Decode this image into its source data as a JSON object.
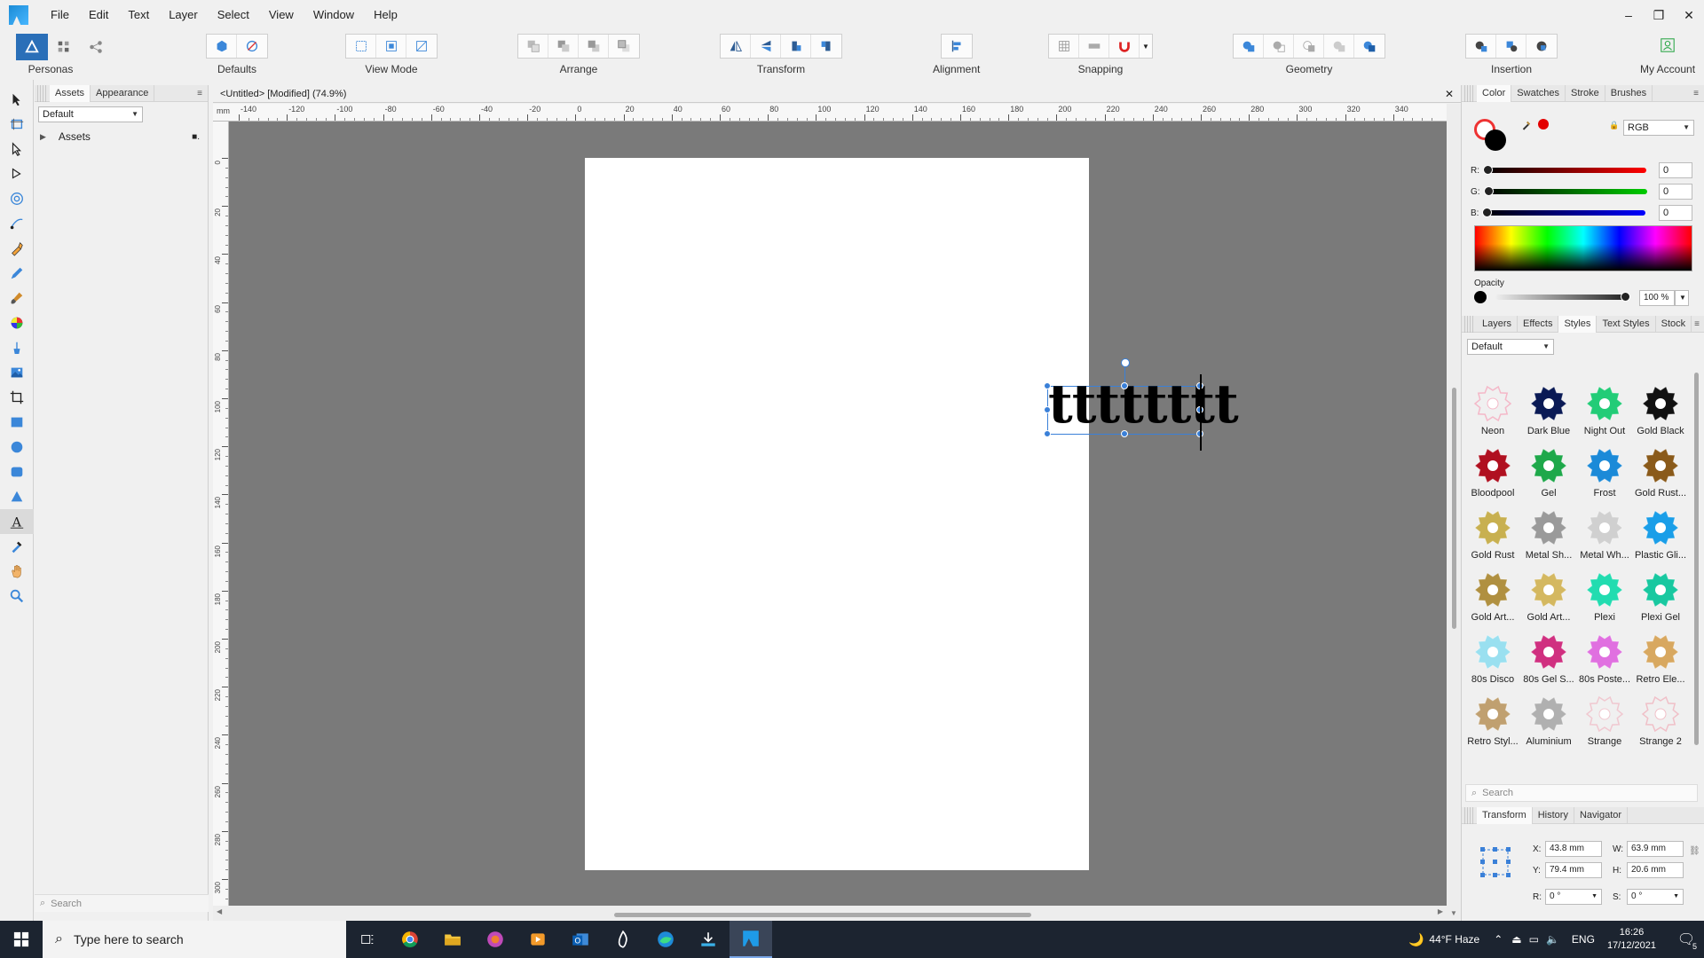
{
  "menubar": {
    "items": [
      "File",
      "Edit",
      "Text",
      "Layer",
      "Select",
      "View",
      "Window",
      "Help"
    ],
    "window_controls": [
      "–",
      "❐",
      "✕"
    ]
  },
  "toolbar": {
    "personas_label": "Personas",
    "defaults_label": "Defaults",
    "view_mode_label": "View Mode",
    "arrange_label": "Arrange",
    "transform_label": "Transform",
    "alignment_label": "Alignment",
    "snapping_label": "Snapping",
    "geometry_label": "Geometry",
    "insertion_label": "Insertion",
    "account_label": "My Account"
  },
  "assets_panel": {
    "tabs": [
      "Assets",
      "Appearance"
    ],
    "dropdown_value": "Default",
    "category": "Assets",
    "search_placeholder": "Search"
  },
  "document": {
    "title": "<Untitled> [Modified] (74.9%)",
    "close": "✕",
    "ruler_unit": "mm",
    "ruler_top_ticks": [
      "-140",
      "-120",
      "-100",
      "-80",
      "-60",
      "-40",
      "-20",
      "0",
      "20",
      "40",
      "60",
      "80",
      "100",
      "120",
      "140",
      "160",
      "180",
      "200",
      "220",
      "240",
      "260",
      "280",
      "300",
      "320",
      "340"
    ],
    "ruler_left_ticks": [
      "0",
      "20",
      "40",
      "60",
      "80",
      "100",
      "120",
      "140",
      "160",
      "180",
      "200",
      "220",
      "240",
      "260",
      "280",
      "300"
    ],
    "text_content": "tttttttt"
  },
  "color_panel": {
    "tabs": [
      "Color",
      "Swatches",
      "Stroke",
      "Brushes"
    ],
    "model": "RGB",
    "channels": [
      {
        "label": "R:",
        "value": "0"
      },
      {
        "label": "G:",
        "value": "0"
      },
      {
        "label": "B:",
        "value": "0"
      }
    ],
    "opacity_label": "Opacity",
    "opacity_value": "100 %",
    "colors": {
      "red": "#e30000",
      "green": "#00b000",
      "blue": "#0000e0"
    }
  },
  "styles_panel": {
    "tabs": [
      "Layers",
      "Effects",
      "Styles",
      "Text Styles",
      "Stock"
    ],
    "dropdown_value": "Default",
    "search_placeholder": "Search",
    "styles": [
      {
        "name": "Neon",
        "color": "#f4b8c8",
        "outline": true
      },
      {
        "name": "Dark Blue",
        "color": "#0a1a55",
        "outline": false
      },
      {
        "name": "Night Out",
        "color": "#22cc77",
        "outline": false
      },
      {
        "name": "Gold Black",
        "color": "#111111",
        "outline": false
      },
      {
        "name": "Bloodpool",
        "color": "#b01020",
        "outline": false
      },
      {
        "name": "Gel",
        "color": "#1ea84a",
        "outline": false
      },
      {
        "name": "Frost",
        "color": "#1b8ad8",
        "outline": false
      },
      {
        "name": "Gold Rust...",
        "color": "#8a5a1a",
        "outline": false
      },
      {
        "name": "Gold Rust",
        "color": "#c8b050",
        "outline": false
      },
      {
        "name": "Metal Sh...",
        "color": "#9a9a9a",
        "outline": false
      },
      {
        "name": "Metal Wh...",
        "color": "#d0d0d0",
        "outline": false
      },
      {
        "name": "Plastic Gli...",
        "color": "#1a9ee8",
        "outline": false
      },
      {
        "name": "Gold Art...",
        "color": "#b09040",
        "outline": false
      },
      {
        "name": "Gold Art...",
        "color": "#d4b860",
        "outline": false
      },
      {
        "name": "Plexi",
        "color": "#22dcb0",
        "outline": false
      },
      {
        "name": "Plexi Gel",
        "color": "#18c8a0",
        "outline": false
      },
      {
        "name": "80s Disco",
        "color": "#9ae0f0",
        "outline": false
      },
      {
        "name": "80s Gel S...",
        "color": "#d03080",
        "outline": false
      },
      {
        "name": "80s Poste...",
        "color": "#e070e0",
        "outline": false
      },
      {
        "name": "Retro Ele...",
        "color": "#d8a860",
        "outline": false
      },
      {
        "name": "Retro Styl...",
        "color": "#c0a070",
        "outline": false
      },
      {
        "name": "Aluminium",
        "color": "#b0b0b0",
        "outline": false
      },
      {
        "name": "Strange",
        "color": "#f0c8d0",
        "outline": true
      },
      {
        "name": "Strange 2",
        "color": "#f0c0c8",
        "outline": true
      },
      {
        "name": "",
        "color": "#111111",
        "outline": false
      }
    ]
  },
  "transform_panel": {
    "tabs": [
      "Transform",
      "History",
      "Navigator"
    ],
    "x_label": "X:",
    "x_value": "43.8 mm",
    "y_label": "Y:",
    "y_value": "79.4 mm",
    "w_label": "W:",
    "w_value": "63.9 mm",
    "h_label": "H:",
    "h_value": "20.6 mm",
    "r_label": "R:",
    "r_value": "0 °",
    "s_label": "S:",
    "s_value": "0 °"
  },
  "taskbar": {
    "search_placeholder": "Type here to search",
    "weather": "44°F  Haze",
    "language": "ENG",
    "time": "16:26",
    "date": "17/12/2021",
    "notifications": "5"
  }
}
